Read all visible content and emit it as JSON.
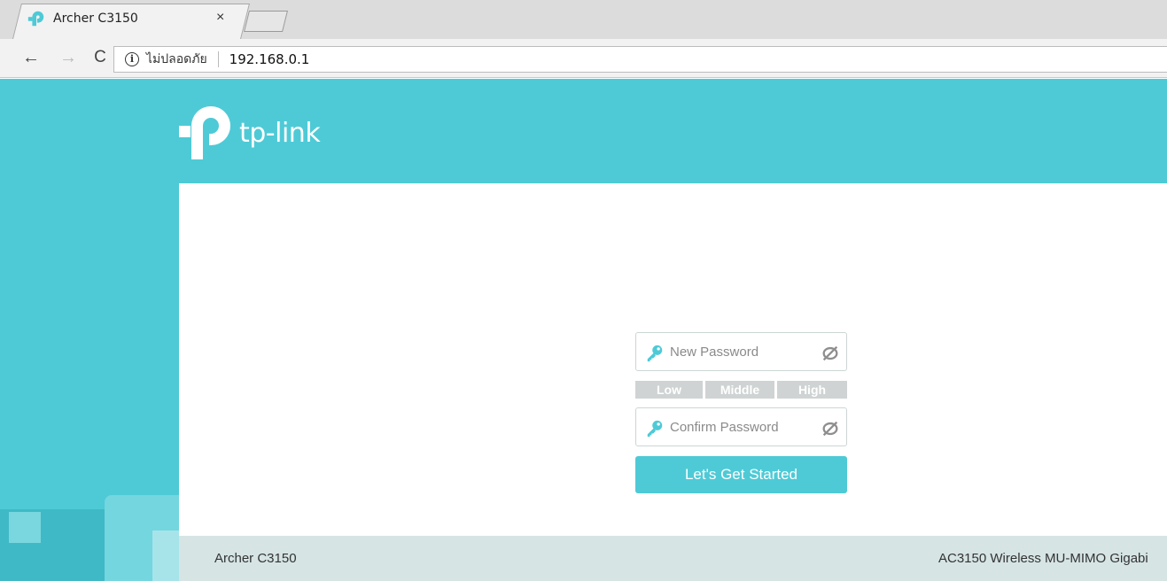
{
  "browser": {
    "tab": {
      "title": "Archer C3150",
      "close_glyph": "×",
      "favicon": "tp-link-logo-icon"
    },
    "nav": {
      "back_glyph": "←",
      "forward_glyph": "→",
      "reload_glyph": "C"
    },
    "address_bar": {
      "security_icon": "info-icon",
      "security_glyph": "i",
      "security_label": "ไม่ปลอดภัย",
      "url": "192.168.0.1"
    }
  },
  "page": {
    "brand": {
      "name": "tp-link"
    },
    "form": {
      "new_password_placeholder": "New Password",
      "confirm_password_placeholder": "Confirm Password",
      "strength_levels": [
        "Low",
        "Middle",
        "High"
      ],
      "submit_label": "Let's Get Started"
    },
    "footer": {
      "model": "Archer C3150",
      "description": "AC3150 Wireless MU-MIMO Gigabi"
    }
  },
  "colors": {
    "brand_teal": "#4ecad6",
    "footer_bg": "#d6e4e4",
    "strength_inactive": "#cfd3d3"
  }
}
